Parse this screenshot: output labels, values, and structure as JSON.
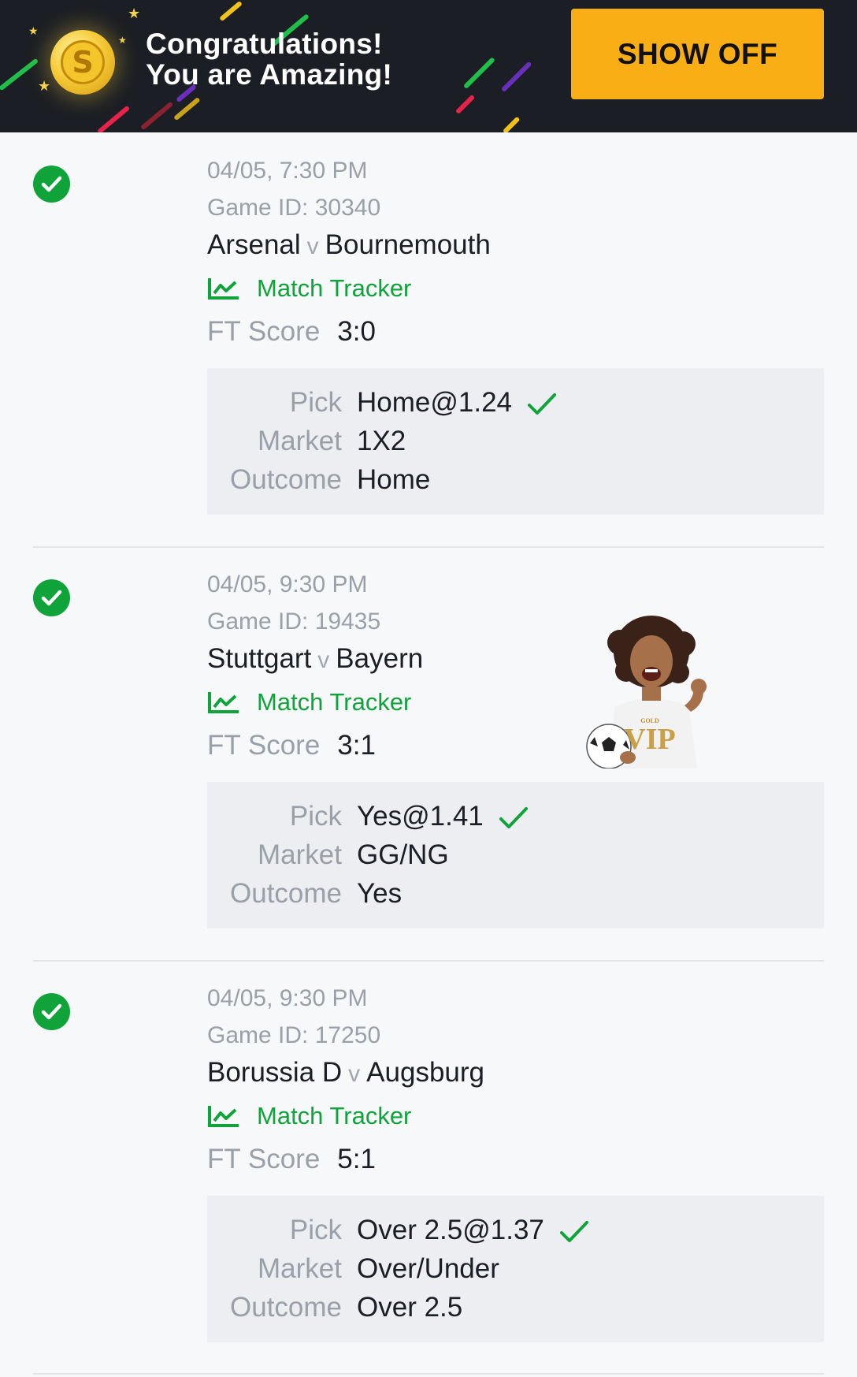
{
  "banner": {
    "line1": "Congratulations!",
    "line2": "You are Amazing!",
    "button_label": "SHOW OFF",
    "coin_symbol": "S"
  },
  "labels": {
    "tracker": "Match Tracker",
    "ft_score": "FT Score",
    "pick": "Pick",
    "market": "Market",
    "outcome": "Outcome",
    "vs": "v"
  },
  "tickets": [
    {
      "datetime": "04/05, 7:30 PM",
      "game_id": "Game ID: 30340",
      "home": "Arsenal",
      "away": "Bournemouth",
      "score": "3:0",
      "pick": "Home@1.24",
      "market": "1X2",
      "outcome": "Home",
      "status": "won"
    },
    {
      "datetime": "04/05, 9:30 PM",
      "game_id": "Game ID: 19435",
      "home": "Stuttgart",
      "away": "Bayern",
      "score": "3:1",
      "pick": "Yes@1.41",
      "market": "GG/NG",
      "outcome": "Yes",
      "status": "won"
    },
    {
      "datetime": "04/05, 9:30 PM",
      "game_id": "Game ID: 17250",
      "home": "Borussia D",
      "away": "Augsburg",
      "score": "5:1",
      "pick": "Over 2.5@1.37",
      "market": "Over/Under",
      "outcome": "Over 2.5",
      "status": "won"
    }
  ],
  "vip_badge": {
    "small": "GOLD",
    "big": "VIP"
  },
  "colors": {
    "accent_green": "#0fa33a",
    "banner_bg": "#1b1e24",
    "button": "#f9ae15"
  }
}
